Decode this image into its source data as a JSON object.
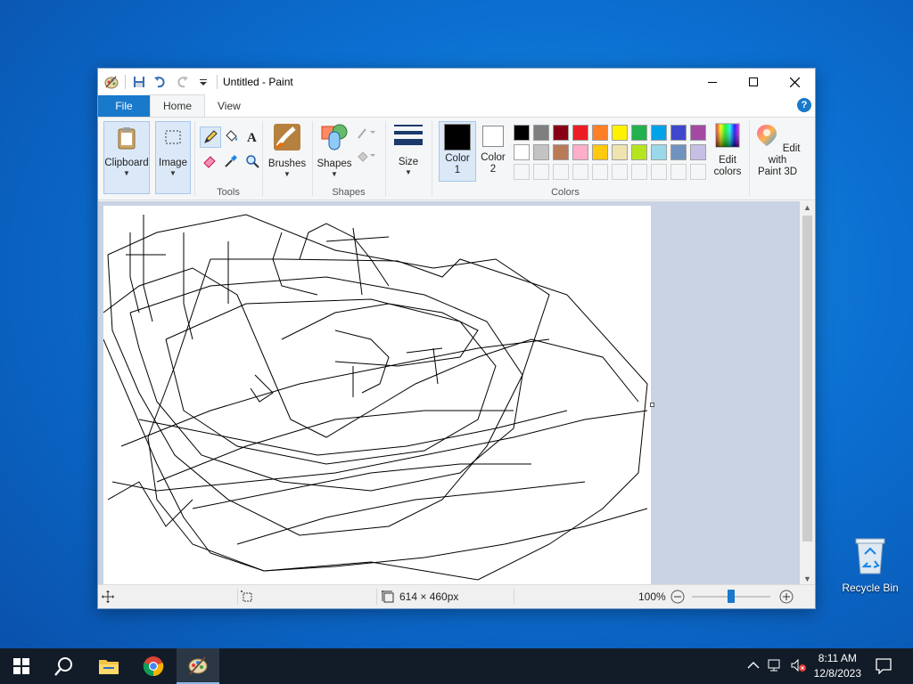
{
  "window": {
    "title": "Untitled - Paint",
    "tabs": {
      "file": "File",
      "home": "Home",
      "view": "View"
    },
    "help": "?"
  },
  "ribbon": {
    "clipboard": "Clipboard",
    "image": "Image",
    "tools": "Tools",
    "brushes": "Brushes",
    "shapes_btn": "Shapes",
    "shapes_group": "Shapes",
    "size": "Size",
    "color1": "Color 1",
    "color1_line1": "Color",
    "color1_line2": "1",
    "color2_line1": "Color",
    "color2_line2": "2",
    "colors_group": "Colors",
    "edit_colors_line1": "Edit",
    "edit_colors_line2": "colors",
    "paint3d_line1": "Edit with",
    "paint3d_line2": "Paint 3D",
    "palette_row1": [
      "#000000",
      "#7f7f7f",
      "#880015",
      "#ed1c24",
      "#ff7f27",
      "#fff200",
      "#22b14c",
      "#00a2e8",
      "#3f48cc",
      "#a349a4"
    ],
    "palette_row2": [
      "#ffffff",
      "#c3c3c3",
      "#b97a57",
      "#ffaec9",
      "#ffc90e",
      "#efe4b0",
      "#b5e61d",
      "#99d9ea",
      "#7092be",
      "#c8bfe7"
    ],
    "color1_value": "#000000",
    "color2_value": "#ffffff"
  },
  "status": {
    "canvas_size": "614 × 460px",
    "zoom": "100%",
    "zoom_level_fraction": 0.5
  },
  "desktop": {
    "recycle_bin": "Recycle Bin"
  },
  "taskbar": {
    "time": "8:11 AM",
    "date": "12/8/2023"
  }
}
